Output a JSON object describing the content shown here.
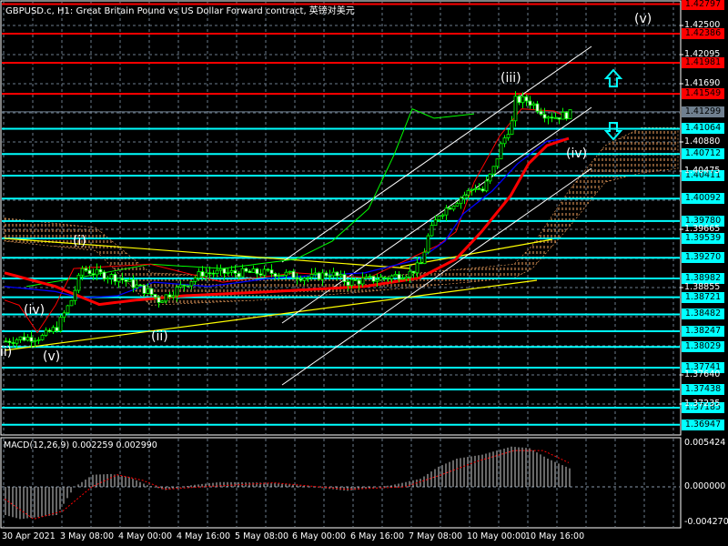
{
  "header": {
    "title": "GBPUSD.c, H1:  Great Britain Pound vs US Dollar Forward contract, 英镑对美元"
  },
  "macd": {
    "label": "MACD(12,26,9) 0.002259 0.002990",
    "axis": [
      "0.005424",
      "0.000000",
      "-0.004270"
    ]
  },
  "price_axis": [
    "1.42500",
    "1.42095",
    "1.41690",
    "1.40880",
    "1.40475",
    "1.39665",
    "1.38855",
    "1.37640",
    "1.37235"
  ],
  "levels": [
    {
      "label": "1.42797",
      "color": "#ff0000"
    },
    {
      "label": "1.42386",
      "color": "#ff0000"
    },
    {
      "label": "1.41981",
      "color": "#ff0000"
    },
    {
      "label": "1.41549",
      "color": "#ff0000"
    },
    {
      "label": "1.41299",
      "color": "#708090"
    },
    {
      "label": "1.41064",
      "color": "#00ffff"
    },
    {
      "label": "1.40712",
      "color": "#00ffff"
    },
    {
      "label": "1.40411",
      "color": "#00ffff"
    },
    {
      "label": "1.40092",
      "color": "#00ffff"
    },
    {
      "label": "1.39780",
      "color": "#00ffff"
    },
    {
      "label": "1.39539",
      "color": "#00ffff"
    },
    {
      "label": "1.39270",
      "color": "#00ffff"
    },
    {
      "label": "1.38982",
      "color": "#00ffff"
    },
    {
      "label": "1.38721",
      "color": "#00ffff"
    },
    {
      "label": "1.38482",
      "color": "#00ffff"
    },
    {
      "label": "1.38247",
      "color": "#00ffff"
    },
    {
      "label": "1.38029",
      "color": "#00ffff"
    },
    {
      "label": "1.37741",
      "color": "#00ffff"
    },
    {
      "label": "1.37438",
      "color": "#00ffff"
    },
    {
      "label": "1.37185",
      "color": "#00ffff"
    },
    {
      "label": "1.36947",
      "color": "#00ffff"
    }
  ],
  "time_axis": [
    "30 Apr 2021",
    "3 May 08:00",
    "4 May 00:00",
    "4 May 16:00",
    "5 May 08:00",
    "6 May 00:00",
    "6 May 16:00",
    "7 May 08:00",
    "10 May 00:00",
    "10 May 16:00"
  ],
  "waves": [
    "(v)",
    "(iii)",
    "(iv)",
    "(i)",
    "(iv)",
    "(ii)",
    "(v)",
    "ii)"
  ],
  "chart_data": {
    "type": "candlestick",
    "symbol": "GBPUSD.c",
    "timeframe": "H1",
    "ylim": [
      1.3665,
      1.4283
    ],
    "close_path": [
      [
        0,
        1.3811
      ],
      [
        4,
        1.3815
      ],
      [
        10,
        1.3817
      ],
      [
        14,
        1.383
      ],
      [
        18,
        1.3868
      ],
      [
        21,
        1.3912
      ],
      [
        24,
        1.3906
      ],
      [
        31,
        1.3899
      ],
      [
        39,
        1.388
      ],
      [
        42,
        1.3868
      ],
      [
        46,
        1.388
      ],
      [
        54,
        1.3906
      ],
      [
        64,
        1.3906
      ],
      [
        74,
        1.3906
      ],
      [
        84,
        1.3899
      ],
      [
        89,
        1.3906
      ],
      [
        94,
        1.3893
      ],
      [
        104,
        1.3899
      ],
      [
        111,
        1.3906
      ],
      [
        114,
        1.3918
      ],
      [
        116,
        1.3956
      ],
      [
        119,
        1.3988
      ],
      [
        124,
        1.4007
      ],
      [
        129,
        1.4026
      ],
      [
        131,
        1.402
      ],
      [
        134,
        1.4051
      ],
      [
        136,
        1.4083
      ],
      [
        139,
        1.4115
      ],
      [
        140,
        1.4146
      ],
      [
        143,
        1.4146
      ],
      [
        145,
        1.414
      ],
      [
        148,
        1.4127
      ],
      [
        151,
        1.4123
      ],
      [
        155,
        1.4127
      ]
    ],
    "ma_thick": [
      [
        0,
        1.3906
      ],
      [
        14,
        1.3887
      ],
      [
        26,
        1.3862
      ],
      [
        36,
        1.3868
      ],
      [
        49,
        1.3874
      ],
      [
        74,
        1.388
      ],
      [
        99,
        1.3887
      ],
      [
        114,
        1.3899
      ],
      [
        124,
        1.3925
      ],
      [
        131,
        1.3963
      ],
      [
        139,
        1.4013
      ],
      [
        144,
        1.4058
      ],
      [
        149,
        1.4083
      ],
      [
        155,
        1.4093
      ]
    ],
    "ma_blue": [
      [
        0,
        1.3887
      ],
      [
        14,
        1.388
      ],
      [
        21,
        1.3871
      ],
      [
        31,
        1.3874
      ],
      [
        41,
        1.3893
      ],
      [
        56,
        1.3887
      ],
      [
        74,
        1.3899
      ],
      [
        99,
        1.3906
      ],
      [
        114,
        1.3925
      ],
      [
        121,
        1.395
      ],
      [
        126,
        1.3988
      ],
      [
        134,
        1.402
      ],
      [
        141,
        1.4058
      ],
      [
        149,
        1.4089
      ],
      [
        155,
        1.4093
      ]
    ],
    "kijun": [
      [
        0,
        1.3868
      ],
      [
        4,
        1.3861
      ],
      [
        9,
        1.3823
      ],
      [
        14,
        1.3861
      ],
      [
        19,
        1.3912
      ],
      [
        40,
        1.3918
      ],
      [
        60,
        1.3893
      ],
      [
        80,
        1.3906
      ],
      [
        100,
        1.3899
      ],
      [
        119,
        1.3944
      ],
      [
        124,
        1.3963
      ],
      [
        129,
        1.4032
      ],
      [
        136,
        1.4096
      ],
      [
        142,
        1.4134
      ],
      [
        151,
        1.4131
      ],
      [
        155,
        1.4121
      ]
    ],
    "chikou": [
      [
        6,
        1.3887
      ],
      [
        20,
        1.3899
      ],
      [
        40,
        1.3918
      ],
      [
        60,
        1.3912
      ],
      [
        80,
        1.3925
      ],
      [
        90,
        1.395
      ],
      [
        100,
        1.3995
      ],
      [
        107,
        1.407
      ],
      [
        112,
        1.4134
      ],
      [
        118,
        1.4121
      ],
      [
        129,
        1.4127
      ]
    ],
    "cloud_top": [
      [
        0,
        1.3982
      ],
      [
        25,
        1.3969
      ],
      [
        40,
        1.3906
      ],
      [
        70,
        1.3899
      ],
      [
        100,
        1.3899
      ],
      [
        140,
        1.3918
      ],
      [
        145,
        1.3944
      ],
      [
        155,
        1.402
      ],
      [
        165,
        1.4083
      ],
      [
        175,
        1.4108
      ],
      [
        185,
        1.4108
      ]
    ],
    "cloud_bottom": [
      [
        0,
        1.395
      ],
      [
        25,
        1.3937
      ],
      [
        40,
        1.3861
      ],
      [
        70,
        1.3868
      ],
      [
        100,
        1.388
      ],
      [
        140,
        1.3899
      ],
      [
        145,
        1.3912
      ],
      [
        155,
        1.3969
      ],
      [
        165,
        1.4032
      ],
      [
        175,
        1.4045
      ],
      [
        185,
        1.4051
      ]
    ],
    "macd_hist": [
      [
        0,
        -0.0035
      ],
      [
        4,
        -0.004
      ],
      [
        14,
        -0.0035
      ],
      [
        19,
        0.0
      ],
      [
        24,
        0.0015
      ],
      [
        29,
        0.0016
      ],
      [
        34,
        0.0012
      ],
      [
        39,
        0.0002
      ],
      [
        44,
        -0.0004
      ],
      [
        51,
        0.0002
      ],
      [
        59,
        0.0006
      ],
      [
        74,
        0.0005
      ],
      [
        94,
        -0.0005
      ],
      [
        106,
        0.0002
      ],
      [
        114,
        0.001
      ],
      [
        119,
        0.0025
      ],
      [
        124,
        0.0035
      ],
      [
        131,
        0.004
      ],
      [
        139,
        0.005
      ],
      [
        144,
        0.0048
      ],
      [
        149,
        0.0035
      ],
      [
        155,
        0.0023
      ]
    ],
    "macd_signal": [
      [
        0,
        -0.0015
      ],
      [
        8,
        -0.004
      ],
      [
        16,
        -0.003
      ],
      [
        24,
        0.0
      ],
      [
        31,
        0.0015
      ],
      [
        38,
        0.0008
      ],
      [
        44,
        -0.0003
      ],
      [
        54,
        0.0
      ],
      [
        74,
        0.0005
      ],
      [
        94,
        -0.0003
      ],
      [
        110,
        0.0
      ],
      [
        120,
        0.0015
      ],
      [
        130,
        0.0032
      ],
      [
        140,
        0.0045
      ],
      [
        148,
        0.0045
      ],
      [
        155,
        0.003
      ]
    ]
  }
}
